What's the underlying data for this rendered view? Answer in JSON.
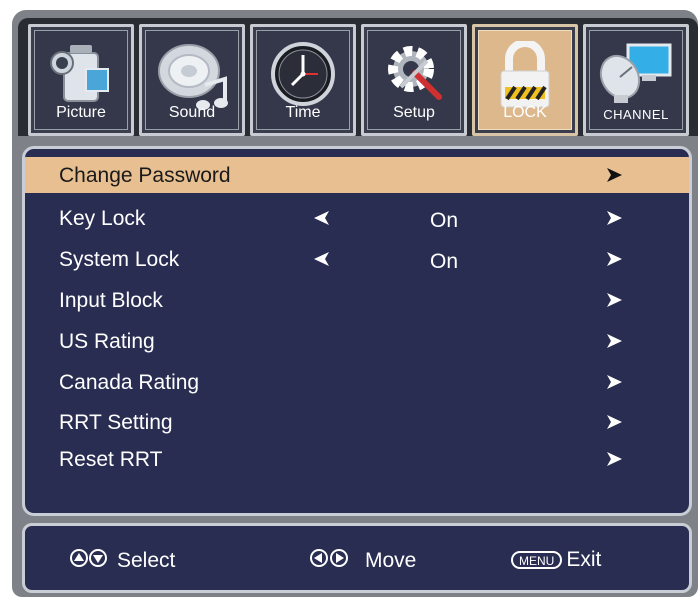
{
  "tabs": [
    {
      "label": "Picture",
      "icon": "camcorder-icon",
      "active": false
    },
    {
      "label": "Sound",
      "icon": "speaker-music-icon",
      "active": false
    },
    {
      "label": "Time",
      "icon": "clock-icon",
      "active": false
    },
    {
      "label": "Setup",
      "icon": "gear-tools-icon",
      "active": false
    },
    {
      "label": "LOCK",
      "icon": "padlock-icon",
      "active": true
    },
    {
      "label": "CHANNEL",
      "icon": "satellite-dish-icon",
      "active": false
    }
  ],
  "menu": {
    "items": [
      {
        "label": "Change Password",
        "value": "",
        "selected": true
      },
      {
        "label": "Key Lock",
        "value": "On",
        "selected": false
      },
      {
        "label": "System Lock",
        "value": "On",
        "selected": false
      },
      {
        "label": "Input Block",
        "value": "",
        "selected": false
      },
      {
        "label": "US Rating",
        "value": "",
        "selected": false
      },
      {
        "label": "Canada Rating",
        "value": "",
        "selected": false
      },
      {
        "label": "RRT Setting",
        "value": "",
        "selected": false
      },
      {
        "label": "Reset RRT",
        "value": "",
        "selected": false
      }
    ]
  },
  "footer": {
    "select_label": "Select",
    "move_label": "Move",
    "menu_key": "MENU",
    "exit_label": "Exit"
  },
  "colors": {
    "panel": "#2a2d52",
    "highlight": "#e7bf90",
    "active_tab": "#ddb88c",
    "frame": "#7e8288"
  }
}
